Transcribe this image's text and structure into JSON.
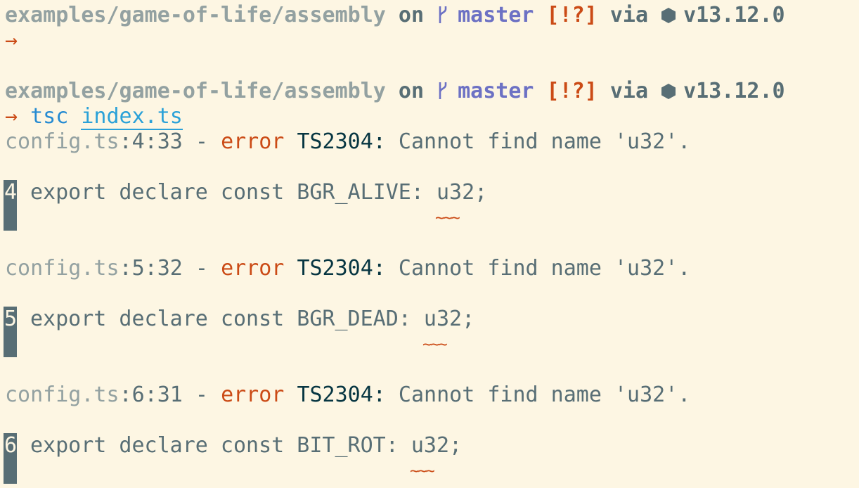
{
  "prompt": {
    "path": "examples/game-of-life/assembly",
    "on_word": "on",
    "branch": "master",
    "status": "[!?]",
    "via_word": "via",
    "node_version": "v13.12.0",
    "arrow": "→"
  },
  "command": {
    "name": "tsc",
    "argument": "index.ts"
  },
  "errors": [
    {
      "file": "config.ts",
      "location": ":4:33 - ",
      "severity": "error",
      "code": "TS2304:",
      "message": " Cannot find name 'u32'.",
      "line_number": "4",
      "source_line": "export declare const BGR_ALIVE: u32;",
      "squiggle": "~~~"
    },
    {
      "file": "config.ts",
      "location": ":5:32 - ",
      "severity": "error",
      "code": "TS2304:",
      "message": " Cannot find name 'u32'.",
      "line_number": "5",
      "source_line": "export declare const BGR_DEAD: u32;",
      "squiggle": "~~~"
    },
    {
      "file": "config.ts",
      "location": ":6:31 - ",
      "severity": "error",
      "code": "TS2304:",
      "message": " Cannot find name 'u32'.",
      "line_number": "6",
      "source_line": "export declare const BIT_ROT: u32;",
      "squiggle": "~~~"
    }
  ],
  "colors": {
    "background": "#fdf6e3",
    "accent_orange": "#cb4b16",
    "accent_violet": "#6c71c4",
    "accent_blue": "#268bd2"
  },
  "icons": {
    "branch_icon": "git-branch-icon",
    "node_icon": "nodejs-hexagon-icon"
  }
}
